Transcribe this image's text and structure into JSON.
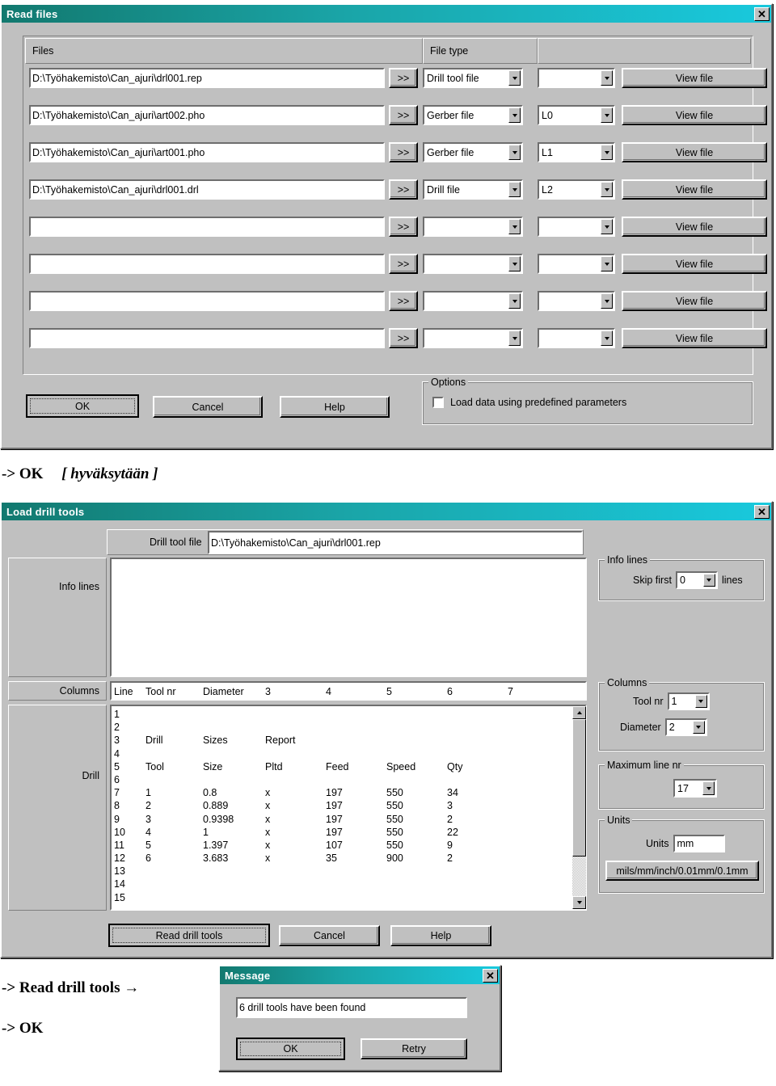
{
  "dialog1": {
    "title": "Read files",
    "close_label": "✕",
    "group_files_label": "Files",
    "group_filetype_label": "File type",
    "browse_label": ">>",
    "view_label": "View file",
    "rows": [
      {
        "path": "D:\\Työhakemisto\\Can_ajuri\\drl001.rep",
        "type": "Drill tool file",
        "layer": ""
      },
      {
        "path": "D:\\Työhakemisto\\Can_ajuri\\art002.pho",
        "type": "Gerber file",
        "layer": "L0"
      },
      {
        "path": "D:\\Työhakemisto\\Can_ajuri\\art001.pho",
        "type": "Gerber file",
        "layer": "L1"
      },
      {
        "path": "D:\\Työhakemisto\\Can_ajuri\\drl001.drl",
        "type": "Drill file",
        "layer": "L2"
      },
      {
        "path": "",
        "type": "",
        "layer": ""
      },
      {
        "path": "",
        "type": "",
        "layer": ""
      },
      {
        "path": "",
        "type": "",
        "layer": ""
      },
      {
        "path": "",
        "type": "",
        "layer": ""
      }
    ],
    "ok_label": "OK",
    "cancel_label": "Cancel",
    "help_label": "Help",
    "options_label": "Options",
    "option_checkbox_label": "Load data using predefined parameters",
    "option_checked": false
  },
  "annotation1": {
    "arrow": "-> OK",
    "bracket": "[ hyväksytään ]"
  },
  "dialog2": {
    "title": "Load drill tools",
    "close_label": "✕",
    "drill_tool_file_label": "Drill tool file",
    "drill_tool_file_value": "D:\\Työhakemisto\\Can_ajuri\\drl001.rep",
    "side_info_lines": "Info lines",
    "side_columns": "Columns",
    "side_drill": "Drill",
    "columns_header": [
      "Line",
      "Tool nr",
      "Diameter",
      "3",
      "4",
      "5",
      "6",
      "7"
    ],
    "listing": [
      {
        "line": "1",
        "c1": "",
        "c2": "",
        "c3": "",
        "c4": "",
        "c5": "",
        "c6": ""
      },
      {
        "line": "2",
        "c1": "",
        "c2": "",
        "c3": "",
        "c4": "",
        "c5": "",
        "c6": ""
      },
      {
        "line": "3",
        "c1": "Drill",
        "c2": "Sizes",
        "c3": "Report",
        "c4": "",
        "c5": "",
        "c6": ""
      },
      {
        "line": "4",
        "c1": "",
        "c2": "",
        "c3": "",
        "c4": "",
        "c5": "",
        "c6": ""
      },
      {
        "line": "5",
        "c1": "Tool",
        "c2": "Size",
        "c3": "Pltd",
        "c4": "Feed",
        "c5": "Speed",
        "c6": "Qty"
      },
      {
        "line": "6",
        "c1": "",
        "c2": "",
        "c3": "",
        "c4": "",
        "c5": "",
        "c6": ""
      },
      {
        "line": "7",
        "c1": "1",
        "c2": "0.8",
        "c3": "x",
        "c4": "197",
        "c5": "550",
        "c6": "34"
      },
      {
        "line": "8",
        "c1": "2",
        "c2": "0.889",
        "c3": "x",
        "c4": "197",
        "c5": "550",
        "c6": "3"
      },
      {
        "line": "9",
        "c1": "3",
        "c2": "0.9398",
        "c3": "x",
        "c4": "197",
        "c5": "550",
        "c6": "2"
      },
      {
        "line": "10",
        "c1": "4",
        "c2": "1",
        "c3": "x",
        "c4": "197",
        "c5": "550",
        "c6": "22"
      },
      {
        "line": "11",
        "c1": "5",
        "c2": "1.397",
        "c3": "x",
        "c4": "107",
        "c5": "550",
        "c6": "9"
      },
      {
        "line": "12",
        "c1": "6",
        "c2": "3.683",
        "c3": "x",
        "c4": "35",
        "c5": "900",
        "c6": "2"
      },
      {
        "line": "13",
        "c1": "",
        "c2": "",
        "c3": "",
        "c4": "",
        "c5": "",
        "c6": ""
      },
      {
        "line": "14",
        "c1": "",
        "c2": "",
        "c3": "",
        "c4": "",
        "c5": "",
        "c6": ""
      },
      {
        "line": "15",
        "c1": "",
        "c2": "",
        "c3": "",
        "c4": "",
        "c5": "",
        "c6": ""
      }
    ],
    "info_lines_group": "Info lines",
    "skip_first_label": "Skip first",
    "skip_first_value": "0",
    "lines_label": "lines",
    "columns_group": "Columns",
    "tool_nr_label": "Tool nr",
    "tool_nr_value": "1",
    "diameter_label": "Diameter",
    "diameter_value": "2",
    "max_line_group": "Maximum line nr",
    "max_line_value": "17",
    "units_group": "Units",
    "units_label": "Units",
    "units_value": "mm",
    "units_button_label": "mils/mm/inch/0.01mm/0.1mm",
    "read_label": "Read drill tools",
    "cancel_label": "Cancel",
    "help_label": "Help"
  },
  "annotation2": {
    "line1": "-> Read drill tools →",
    "line2": "-> OK"
  },
  "dialog3": {
    "title": "Message",
    "close_label": "✕",
    "message": "6 drill tools have been found",
    "ok_label": "OK",
    "retry_label": "Retry"
  }
}
